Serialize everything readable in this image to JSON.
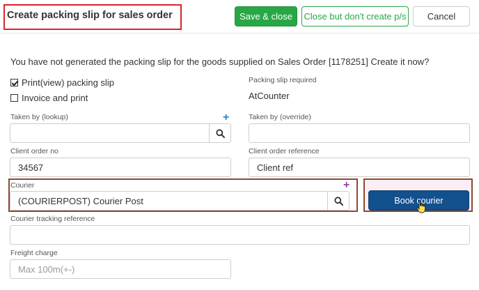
{
  "header": {
    "title": "Create packing slip for sales order",
    "save_label": "Save & close",
    "close_label": "Close but don't create p/s",
    "cancel_label": "Cancel"
  },
  "message": "You have not generated the packing slip for the goods supplied on Sales Order [1178251] Create it now?",
  "options": {
    "print_label": "Print(view) packing slip",
    "print_checked": true,
    "invoice_label": "Invoice and print",
    "invoice_checked": false
  },
  "packing_slip": {
    "label": "Packing slip required",
    "value": "AtCounter"
  },
  "taken_by_lookup": {
    "label": "Taken by (lookup)",
    "value": ""
  },
  "taken_by_override": {
    "label": "Taken by (override)",
    "value": ""
  },
  "client_order_no": {
    "label": "Client order no",
    "value": "34567"
  },
  "client_order_reference": {
    "label": "Client order reference",
    "value": "Client ref"
  },
  "courier": {
    "label": "Courier",
    "value": "(COURIERPOST) Courier Post"
  },
  "book_courier_label": "Book courier",
  "courier_tracking": {
    "label": "Courier tracking reference",
    "value": ""
  },
  "freight_charge": {
    "label": "Freight charge",
    "placeholder": "Max 100m(+-)"
  },
  "colors": {
    "save_green": "#28a745",
    "book_blue": "#12508e",
    "highlight_red": "#d9252b",
    "highlight_brown": "#8b4a2e",
    "plus_blue": "#2e86c1",
    "plus_purple": "#8e44ad"
  }
}
